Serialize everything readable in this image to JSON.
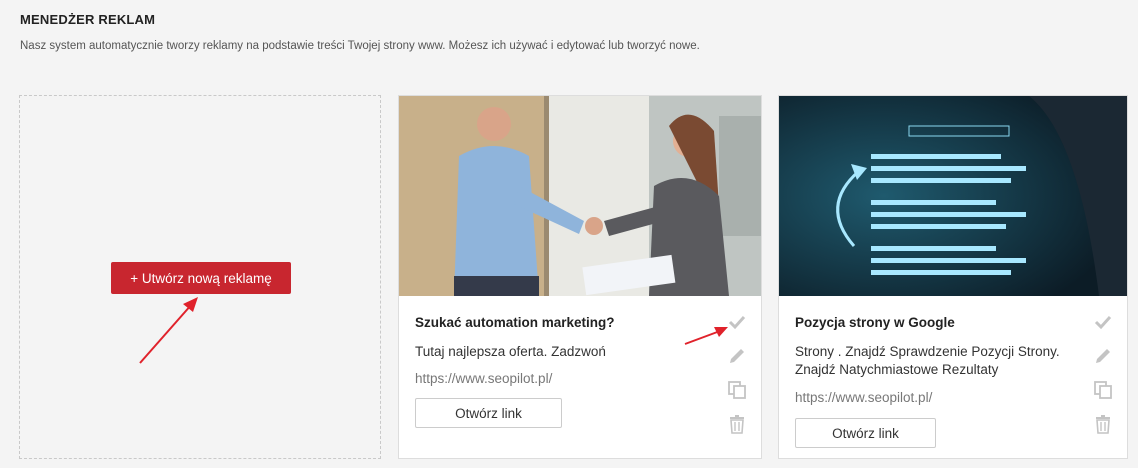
{
  "header": {
    "title": "MENEDŻER REKLAM",
    "subtitle": "Nasz system automatycznie tworzy reklamy na podstawie treści Twojej strony www. Możesz ich używać i edytować lub tworzyć nowe."
  },
  "create": {
    "button_label": "+ Utwórz nową reklamę"
  },
  "ads": [
    {
      "title": "Szukać automation marketing?",
      "description": "Tutaj najlepsza oferta. Zadzwoń",
      "url": "https://www.seopilot.pl/",
      "open_label": "Otwórz link",
      "image": "handshake-photo"
    },
    {
      "title": "Pozycja strony w Google",
      "description": "Strony . Znajdź Sprawdzenie Pozycji Strony. Znajdź Natychmiastowe Rezultaty",
      "url": "https://www.seopilot.pl/",
      "open_label": "Otwórz link",
      "image": "search-results-photo"
    }
  ],
  "icons": [
    "check-icon",
    "edit-icon",
    "copy-icon",
    "trash-icon"
  ],
  "colors": {
    "accent": "#c8262f",
    "background": "#f4f4f4",
    "icon": "#c4c4c4",
    "arrow": "#e0222b"
  }
}
